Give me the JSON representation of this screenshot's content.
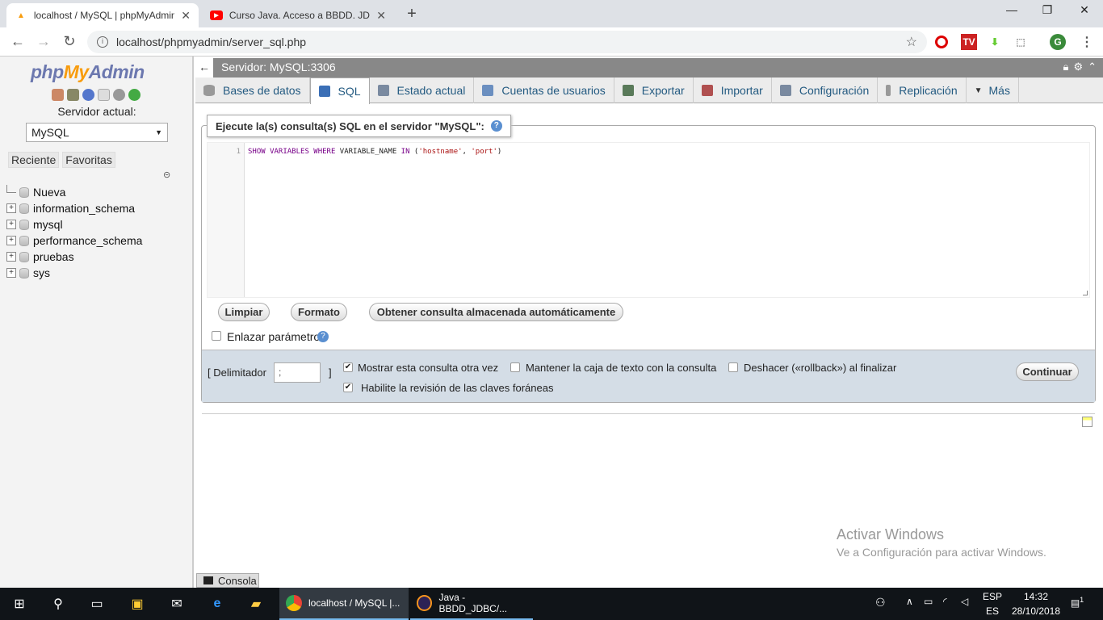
{
  "browser": {
    "tabs": [
      {
        "title": "localhost / MySQL | phpMyAdmin",
        "active": true
      },
      {
        "title": "Curso Java. Acceso a BBDD. JDBC",
        "active": false
      }
    ],
    "url": "localhost/phpmyadmin/server_sql.php",
    "profile_initial": "G"
  },
  "leftnav": {
    "logo": {
      "php": "php",
      "my": "My",
      "admin": "Admin"
    },
    "server_label": "Servidor actual:",
    "server_value": "MySQL",
    "tabs": [
      "Reciente",
      "Favoritas"
    ],
    "databases": [
      {
        "name": "Nueva",
        "expandable": false
      },
      {
        "name": "information_schema",
        "expandable": true
      },
      {
        "name": "mysql",
        "expandable": true
      },
      {
        "name": "performance_schema",
        "expandable": true
      },
      {
        "name": "pruebas",
        "expandable": true
      },
      {
        "name": "sys",
        "expandable": true
      }
    ]
  },
  "topbar": {
    "server": "Servidor: MySQL:3306"
  },
  "main_tabs": [
    {
      "label": "Bases de datos",
      "icon": "database-icon",
      "color": "#999999"
    },
    {
      "label": "SQL",
      "icon": "sql-icon",
      "color": "#3b6fb6",
      "active": true
    },
    {
      "label": "Estado actual",
      "icon": "status-icon",
      "color": "#7a8aa0"
    },
    {
      "label": "Cuentas de usuarios",
      "icon": "users-icon",
      "color": "#6b8fc0"
    },
    {
      "label": "Exportar",
      "icon": "export-icon",
      "color": "#5a7a5a"
    },
    {
      "label": "Importar",
      "icon": "import-icon",
      "color": "#b05050"
    },
    {
      "label": "Configuración",
      "icon": "wrench-icon",
      "color": "#7a8aa0"
    },
    {
      "label": "Replicación",
      "icon": "replication-icon",
      "color": "#999999"
    },
    {
      "label": "Más",
      "icon": "chevron-down-icon",
      "color": "#333333"
    }
  ],
  "sql": {
    "legend": "Ejecute la(s) consulta(s) SQL en el servidor \"MySQL\":",
    "line_number": "1",
    "query_kw1": "SHOW VARIABLES WHERE",
    "query_mid": " VARIABLE_NAME ",
    "query_kw2": "IN",
    "query_open": " (",
    "query_str1": "'hostname'",
    "query_sep": ", ",
    "query_str2": "'port'",
    "query_close": ")",
    "buttons": {
      "clear": "Limpiar",
      "format": "Formato",
      "auto": "Obtener consulta almacenada automáticamente"
    },
    "bind_params": "Enlazar parámetros",
    "delimiter_label": "[ Delimitador",
    "delimiter_close": "]",
    "delimiter_value": ";",
    "options": {
      "show_again": {
        "label": "Mostrar esta consulta otra vez",
        "checked": true
      },
      "keep_box": {
        "label": "Mantener la caja de texto con la consulta",
        "checked": false
      },
      "rollback": {
        "label": "Deshacer («rollback») al finalizar",
        "checked": false
      },
      "fk_checks": {
        "label": "Habilite la revisión de las claves foráneas",
        "checked": true
      }
    },
    "go": "Continuar"
  },
  "console": "Consola",
  "watermark": {
    "title": "Activar Windows",
    "subtitle": "Ve a Configuración para activar Windows."
  },
  "taskbar": {
    "apps": [
      {
        "label": "localhost / MySQL |...",
        "active": true
      },
      {
        "label": "Java - BBDD_JDBC/...",
        "active": false
      }
    ],
    "lang_top": "ESP",
    "lang_bottom": "ES",
    "time": "14:32",
    "date": "28/10/2018",
    "notifications": "1"
  }
}
